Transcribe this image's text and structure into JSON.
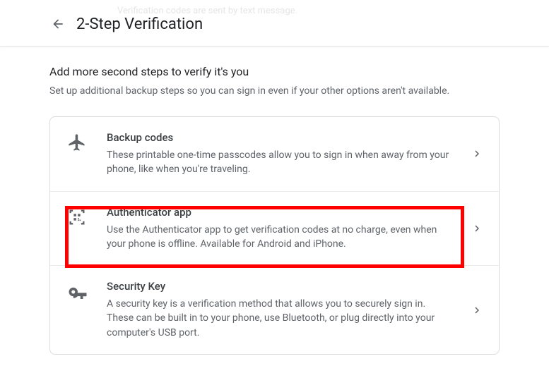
{
  "ghost": "Verification codes are sent by text message.",
  "header": {
    "title": "2-Step Verification"
  },
  "section": {
    "heading": "Add more second steps to verify it's you",
    "sub": "Set up additional backup steps so you can sign in even if your other options aren't available."
  },
  "rows": {
    "backup": {
      "title": "Backup codes",
      "desc": "These printable one-time passcodes allow you to sign in when away from your phone, like when you're traveling."
    },
    "auth": {
      "title": "Authenticator app",
      "desc": "Use the Authenticator app to get verification codes at no charge, even when your phone is offline. Available for Android and iPhone."
    },
    "key": {
      "title": "Security Key",
      "desc": "A security key is a verification method that allows you to securely sign in. These can be built in to your phone, use Bluetooth, or plug directly into your computer's USB port."
    }
  }
}
